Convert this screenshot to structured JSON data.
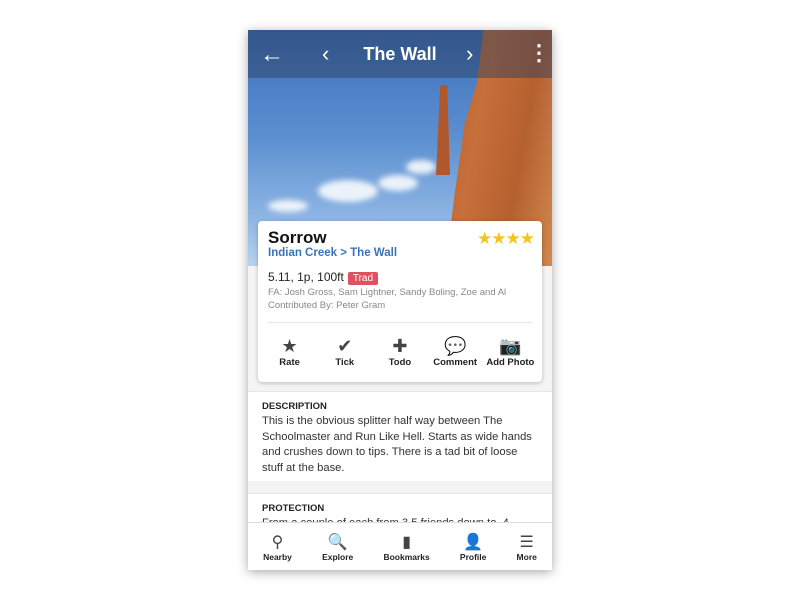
{
  "header": {
    "title": "The Wall",
    "back_icon": "arrow-left-icon",
    "prev_icon": "chevron-left-icon",
    "next_icon": "chevron-right-icon",
    "menu_icon": "more-vertical-icon"
  },
  "route": {
    "name": "Sorrow",
    "rating_stars": 4,
    "stars_text": "★★★★",
    "area": "Indian Creek",
    "crag": "The Wall",
    "crumb_sep": ">",
    "grade_info": "5.11, 1p, 100ft",
    "type_badge": "Trad",
    "badge_color": "#e0505e",
    "fa": "FA: Josh Gross, Sam Lightner, Sandy Boling, Zoe and Al",
    "contributed": "Contributed By: Peter Gram"
  },
  "actions": [
    {
      "label": "Rate",
      "icon": "★"
    },
    {
      "label": "Tick",
      "icon": "✔"
    },
    {
      "label": "Todo",
      "icon": "✚"
    },
    {
      "label": "Comment",
      "icon": "💬"
    },
    {
      "label": "Add Photo",
      "icon": "📷"
    }
  ],
  "description": {
    "heading": "DESCRIPTION",
    "text": "This is the obvious splitter half way between The Schoolmaster and Run Like Hell. Starts as wide hands and crushes down to tips. There is a tad bit of loose stuff at the base."
  },
  "protection": {
    "heading": "PROTECTION",
    "text": "From a couple of each from 3.5 friends down to .4"
  },
  "tabbar": [
    {
      "label": "Nearby",
      "icon": "⚲"
    },
    {
      "label": "Explore",
      "icon": "🔍"
    },
    {
      "label": "Bookmarks",
      "icon": "▮"
    },
    {
      "label": "Profile",
      "icon": "👤"
    },
    {
      "label": "More",
      "icon": "☰"
    }
  ]
}
